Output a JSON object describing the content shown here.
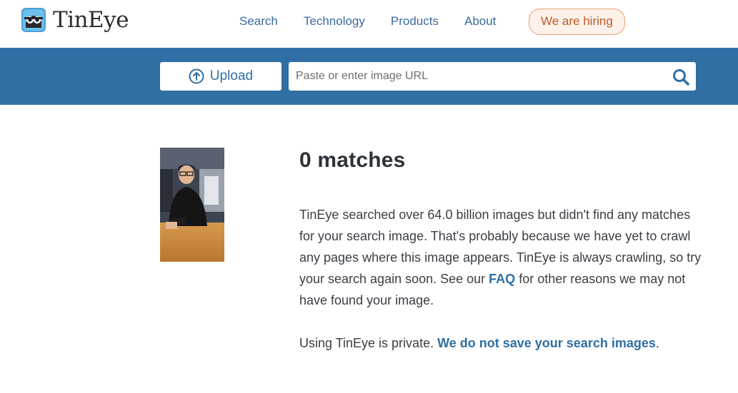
{
  "brand": {
    "name": "TinEye"
  },
  "nav": {
    "items": [
      "Search",
      "Technology",
      "Products",
      "About"
    ],
    "hiring": "We are hiring"
  },
  "search": {
    "upload_label": "Upload",
    "placeholder": "Paste or enter image URL",
    "value": ""
  },
  "result": {
    "heading": "0 matches",
    "para1_text1": "TinEye searched over 64.0 billion images but didn't find any matches for your search image. That's probably because we have yet to crawl any pages where this image appears. TinEye is always crawling, so try your search again soon. See our ",
    "para1_link": "FAQ",
    "para1_text2": " for other reasons we may not have found your image.",
    "para2_text1": "Using TinEye is private. ",
    "para2_link": "We do not save your search images",
    "para2_text2": "."
  },
  "colors": {
    "brand_blue": "#2f6fa4",
    "link_blue": "#3b6aa0",
    "hiring_orange": "#c0592a"
  },
  "icons": {
    "upload": "arrow-up-circle-icon",
    "search": "magnifier-icon",
    "logo": "tineye-robot-logo"
  }
}
